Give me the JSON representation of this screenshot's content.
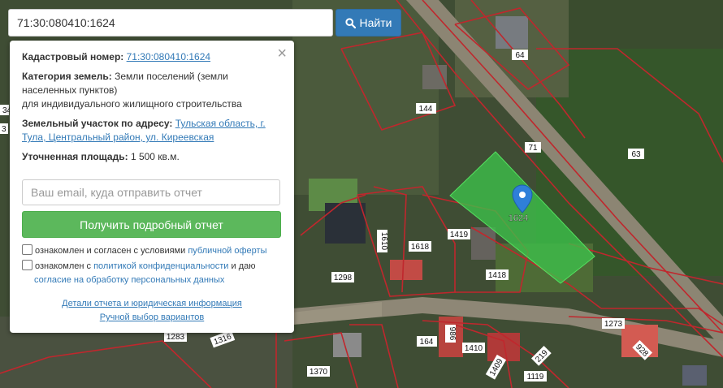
{
  "search": {
    "value": "71:30:080410:1624",
    "button_label": "Найти",
    "button_icon": "search-icon"
  },
  "panel": {
    "cadastral_label": "Кадастровый номер:",
    "cadastral_value": "71:30:080410:1624",
    "category_label": "Категория земель:",
    "category_value_1": "Земли поселений (земли",
    "category_value_2": "населенных пунктов)",
    "category_value_3": "для индивидуального жилищного строительства",
    "address_label": "Земельный участок по адресу:",
    "address_link_1": "Тульская область, г.",
    "address_link_2": "Тула, Центральный район, ул. Киреевская",
    "area_label": "Уточненная площадь:",
    "area_value": "1 500 кв.м.",
    "email_placeholder": "Ваш email, куда отправить отчет",
    "report_button": "Получить подробный отчет",
    "consent1_text": "ознакомлен и согласен с условиями ",
    "consent1_link": "публичной оферты",
    "consent2_text": "ознакомлен с ",
    "consent2_link": "политикой конфиденциальности",
    "consent2_and": " и даю",
    "consent2_link2": "согласие на обработку персональных данных",
    "details_link": "Детали отчета и юридическая информация",
    "manual_link": "Ручной выбор вариантов",
    "close_icon": "close-icon"
  },
  "map": {
    "marker_label": "1624",
    "labels": [
      "64",
      "144",
      "71",
      "63",
      "1610",
      "1618",
      "1419",
      "1418",
      "1298",
      "1273",
      "1283",
      "1316",
      "164",
      "986",
      "1410",
      "219",
      "928",
      "1409",
      "1119",
      "1370",
      "34",
      "3"
    ],
    "colors": {
      "parcel_fill": "#3cc24a",
      "boundary": "#c0272d",
      "marker": "#2f7fd9"
    }
  }
}
